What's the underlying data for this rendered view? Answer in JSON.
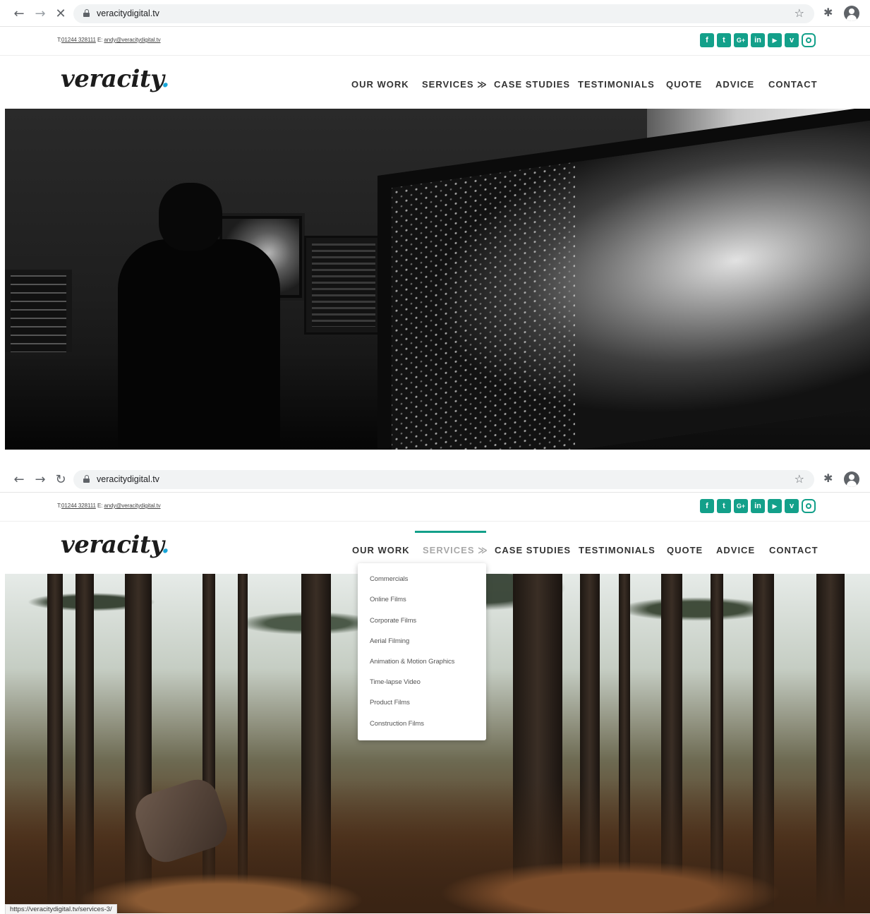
{
  "browser": {
    "url": "veracitydigital.tv",
    "status_url": "https://veracitydigital.tv/services-3/"
  },
  "site": {
    "contact": {
      "phone_prefix": "T:",
      "phone": "01244 328111",
      "email_prefix": "E:",
      "email": "andy@veracitydigital.tv"
    },
    "socials": [
      "facebook-icon",
      "twitter-icon",
      "google-plus-icon",
      "linkedin-icon",
      "youtube-icon",
      "vimeo-icon",
      "instagram-icon"
    ],
    "logo": {
      "text": "veracity",
      "dot": "."
    },
    "menu": {
      "our_work": "OUR WORK",
      "services": "SERVICES ≫",
      "case_studies": "CASE STUDIES",
      "testimonials": "TESTIMONIALS",
      "quote": "QUOTE",
      "advice": "ADVICE",
      "contact": "CONTACT"
    },
    "services_dropdown": [
      "Commercials",
      "Online Films",
      "Corporate Films",
      "Aerial Filming",
      "Animation & Motion Graphics",
      "Time-lapse Video",
      "Product Films",
      "Construction Films"
    ],
    "colors": {
      "accent": "#13a08a",
      "logo_dot": "#19a6d8"
    }
  }
}
